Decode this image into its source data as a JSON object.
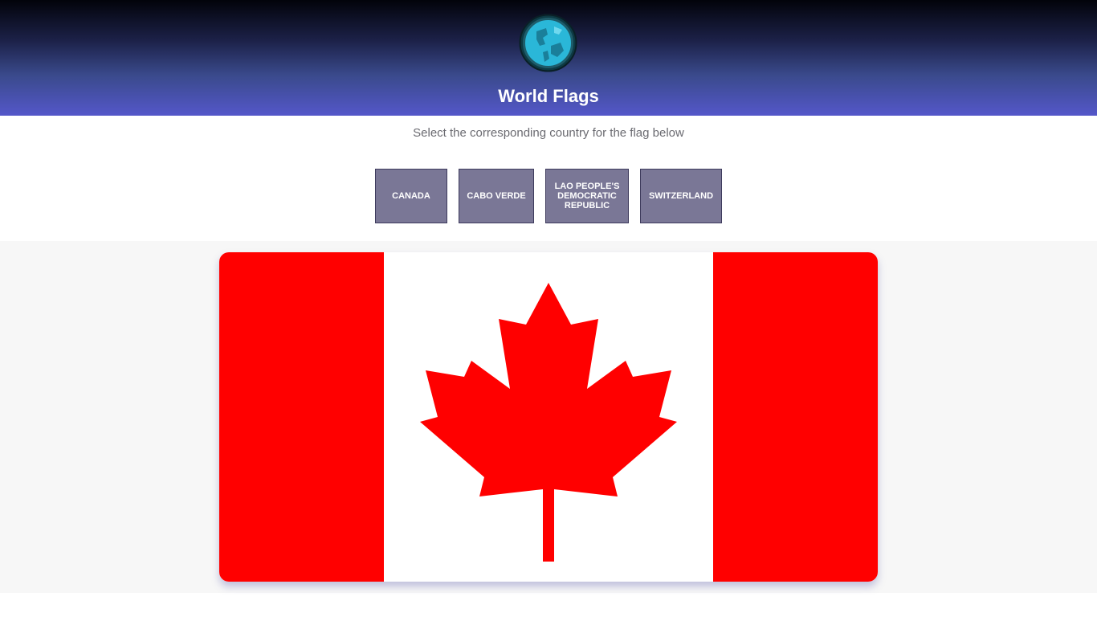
{
  "header": {
    "title": "World Flags",
    "logo_icon": "globe-icon"
  },
  "quiz": {
    "instruction": "Select the corresponding country for the flag below",
    "options": [
      {
        "label": "CANADA"
      },
      {
        "label": "CABO VERDE"
      },
      {
        "label": "LAO PEOPLE'S DEMOCRATIC REPUBLIC"
      },
      {
        "label": "SWITZERLAND"
      }
    ]
  },
  "flag": {
    "icon": "canada-flag-icon",
    "colors": {
      "red": "#ff0000",
      "white": "#ffffff"
    }
  },
  "colors": {
    "header_bottom": "#5457c9",
    "header_top": "#02030a",
    "button_bg": "#7a7796"
  }
}
